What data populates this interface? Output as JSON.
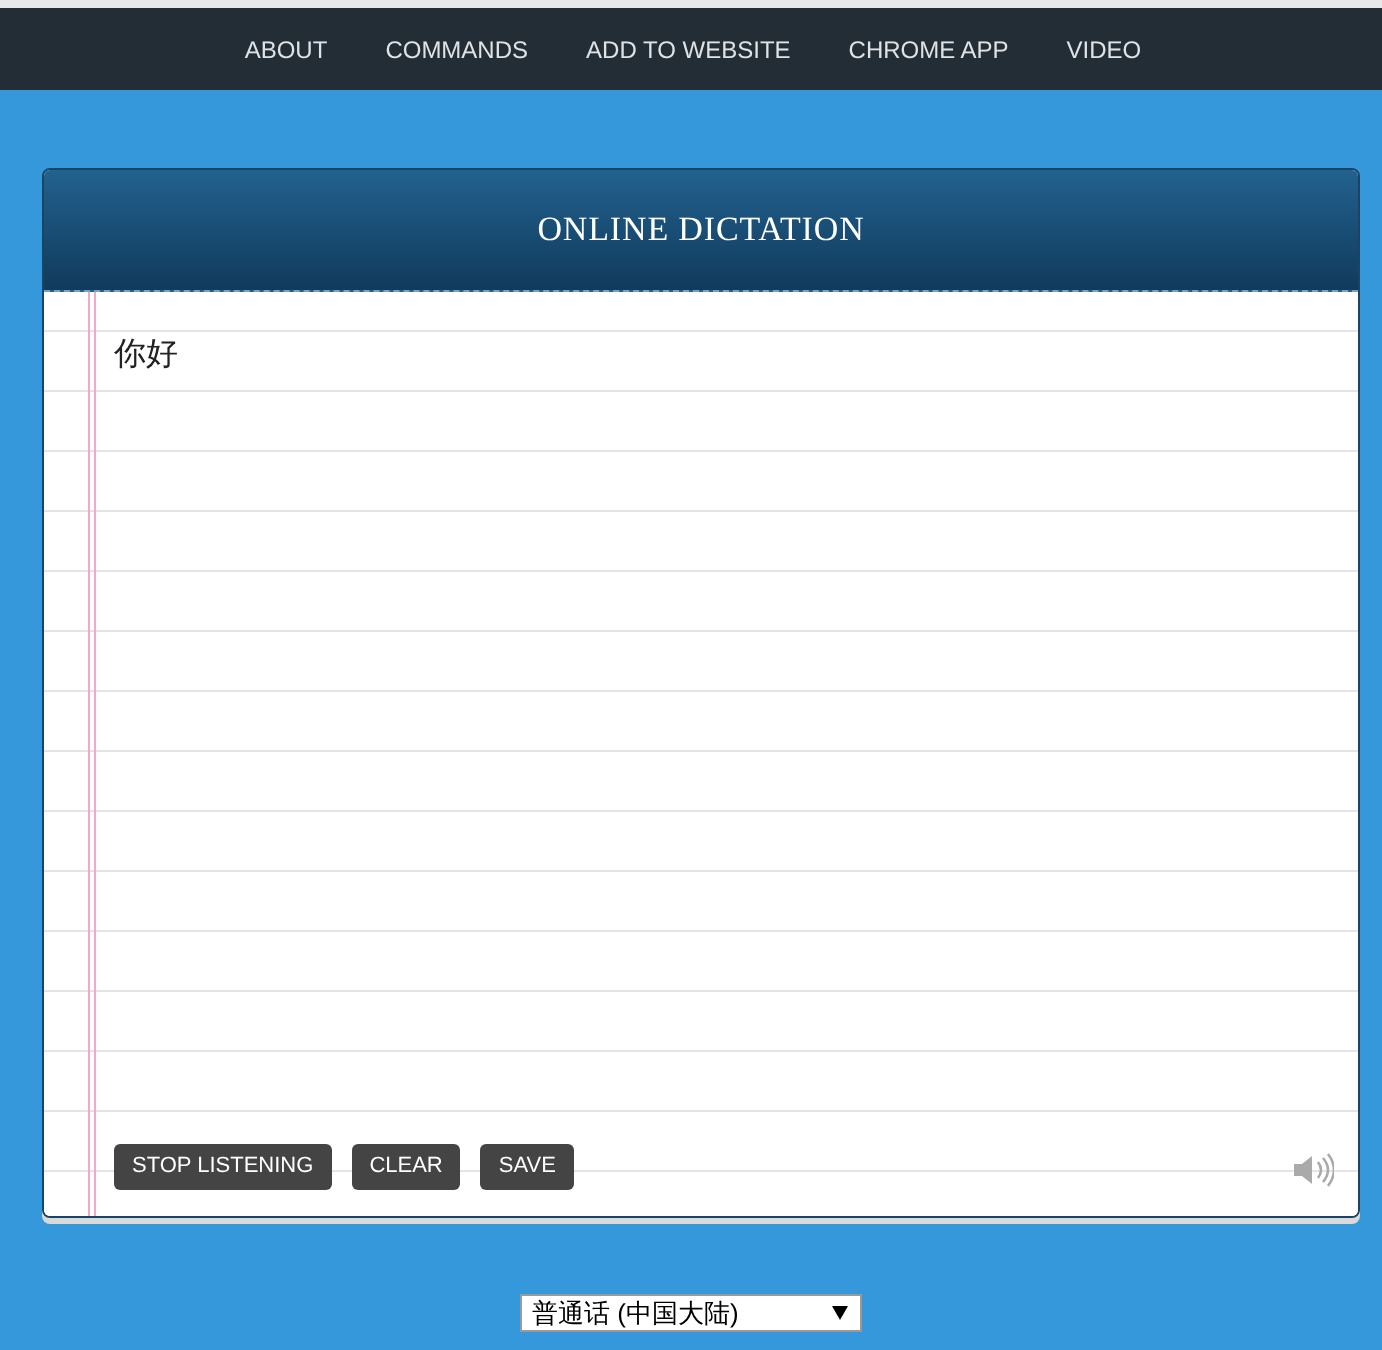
{
  "nav": {
    "items": [
      "ABOUT",
      "COMMANDS",
      "ADD TO WEBSITE",
      "CHROME APP",
      "VIDEO"
    ]
  },
  "card": {
    "title": "ONLINE DICTATION",
    "text": "你好",
    "buttons": [
      "STOP LISTENING",
      "CLEAR",
      "SAVE"
    ]
  },
  "language_select": {
    "value": "普通话 (中国大陆)"
  }
}
